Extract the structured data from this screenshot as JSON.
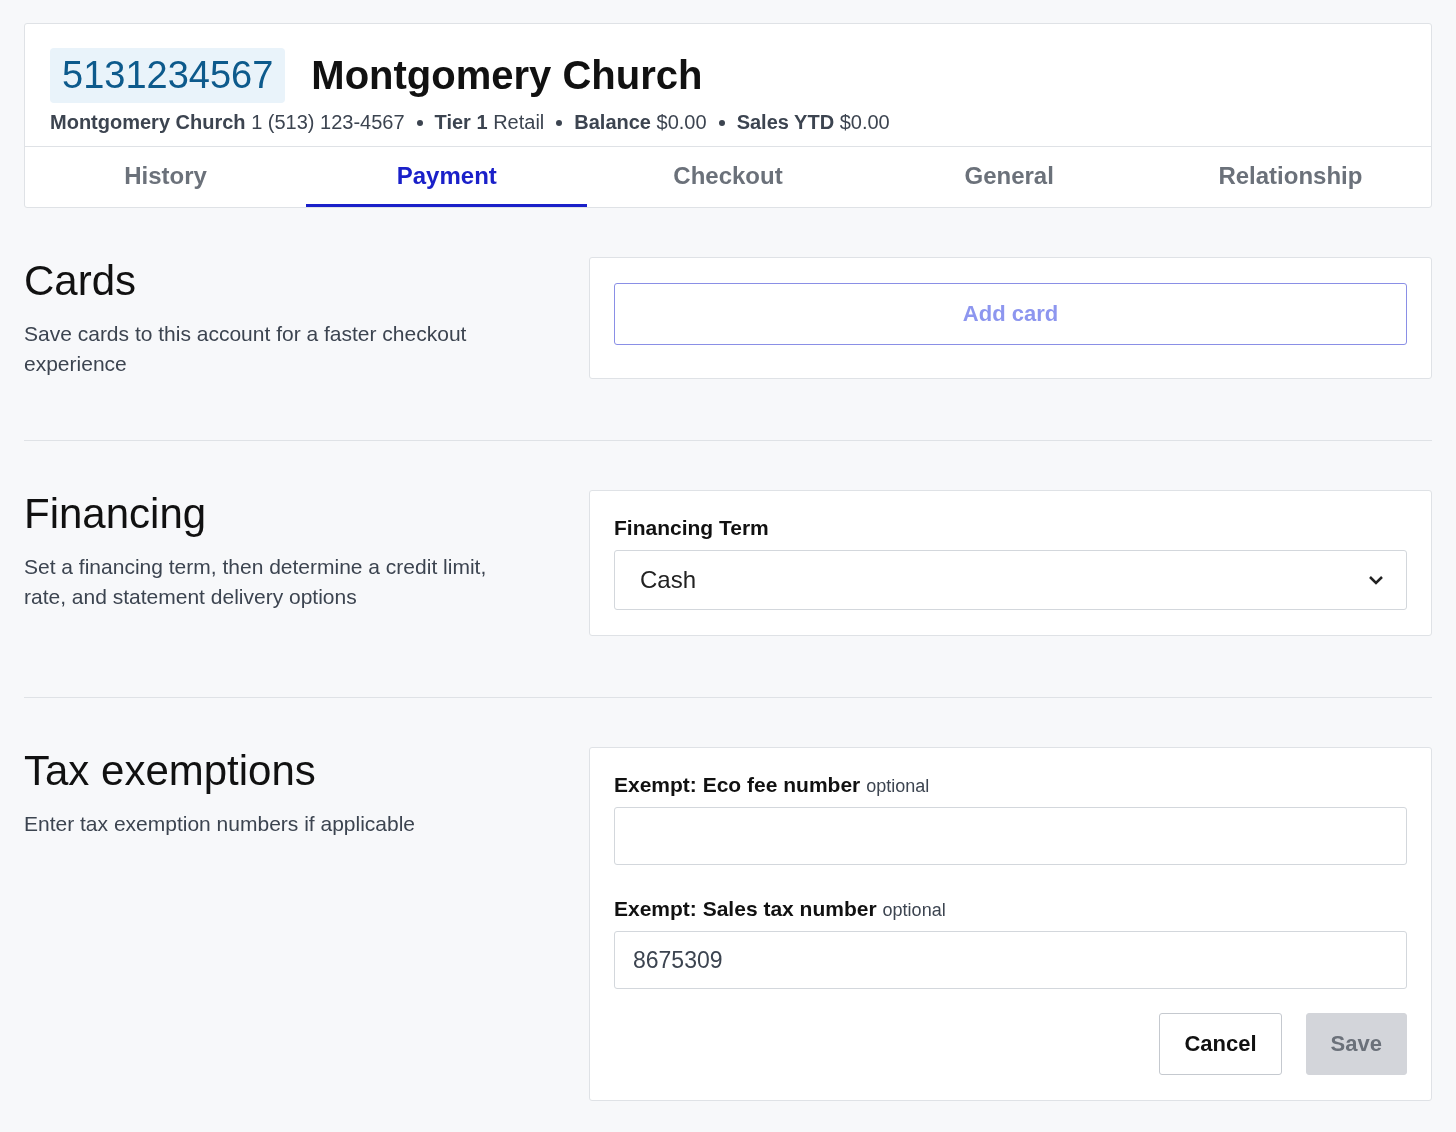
{
  "header": {
    "account_number": "5131234567",
    "name": "Montgomery Church",
    "details": [
      {
        "label": "Montgomery Church",
        "value": "1 (513) 123-4567"
      },
      {
        "label": "Tier 1",
        "value": "Retail"
      },
      {
        "label": "Balance",
        "value": "$0.00"
      },
      {
        "label": "Sales YTD",
        "value": "$0.00"
      }
    ]
  },
  "tabs": [
    {
      "label": "History",
      "selected": false
    },
    {
      "label": "Payment",
      "selected": true
    },
    {
      "label": "Checkout",
      "selected": false
    },
    {
      "label": "General",
      "selected": false
    },
    {
      "label": "Relationship",
      "selected": false
    }
  ],
  "sections": [
    {
      "kind": "cards",
      "title": "Cards",
      "description": "Save cards to this account for a faster checkout experience",
      "button": "Add card"
    },
    {
      "kind": "select",
      "title": "Financing",
      "description": "Set a financing term, then determine a credit limit, rate, and statement delivery options",
      "label": "Financing Term",
      "value": "Cash"
    },
    {
      "kind": "fields",
      "title": "Tax exemptions",
      "description": "Enter tax exemption numbers if applicable",
      "fields": [
        {
          "label": "Exempt: Eco fee number",
          "hint": "optional"
        },
        {
          "label": "Exempt: Sales tax number",
          "hint": "optional",
          "value": "8675309"
        }
      ],
      "buttons": [
        {
          "label": "Cancel",
          "disabled": false
        },
        {
          "label": "Save",
          "disabled": true
        }
      ]
    }
  ]
}
